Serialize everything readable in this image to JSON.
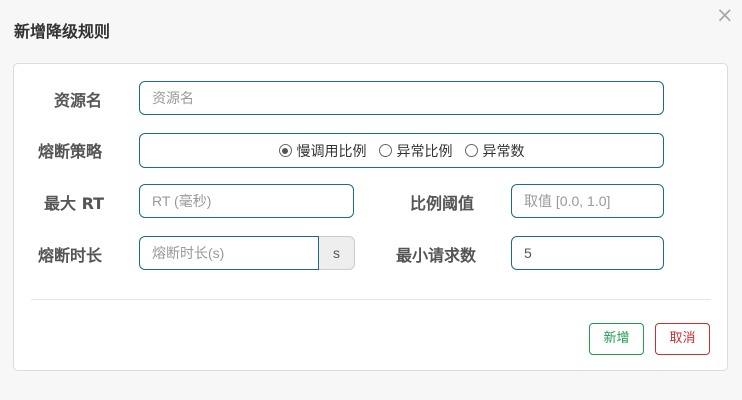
{
  "dialog": {
    "title": "新增降级规则",
    "close_symbol": "×"
  },
  "form": {
    "resource": {
      "label": "资源名",
      "placeholder": "资源名",
      "value": ""
    },
    "strategy": {
      "label": "熔断策略",
      "options": [
        {
          "label": "慢调用比例",
          "checked": true
        },
        {
          "label": "异常比例",
          "checked": false
        },
        {
          "label": "异常数",
          "checked": false
        }
      ]
    },
    "max_rt": {
      "label": "最大 RT",
      "placeholder": "RT (毫秒)",
      "value": ""
    },
    "ratio_threshold": {
      "label": "比例阈值",
      "placeholder": "取值 [0.0, 1.0]",
      "value": ""
    },
    "duration": {
      "label": "熔断时长",
      "placeholder": "熔断时长(s)",
      "value": "",
      "unit": "s"
    },
    "min_requests": {
      "label": "最小请求数",
      "value": "5"
    }
  },
  "actions": {
    "add_label": "新增",
    "cancel_label": "取消"
  },
  "colors": {
    "input_border": "#1b6d85",
    "add_button": "#1e9d4f",
    "cancel_button": "#c9302c"
  }
}
